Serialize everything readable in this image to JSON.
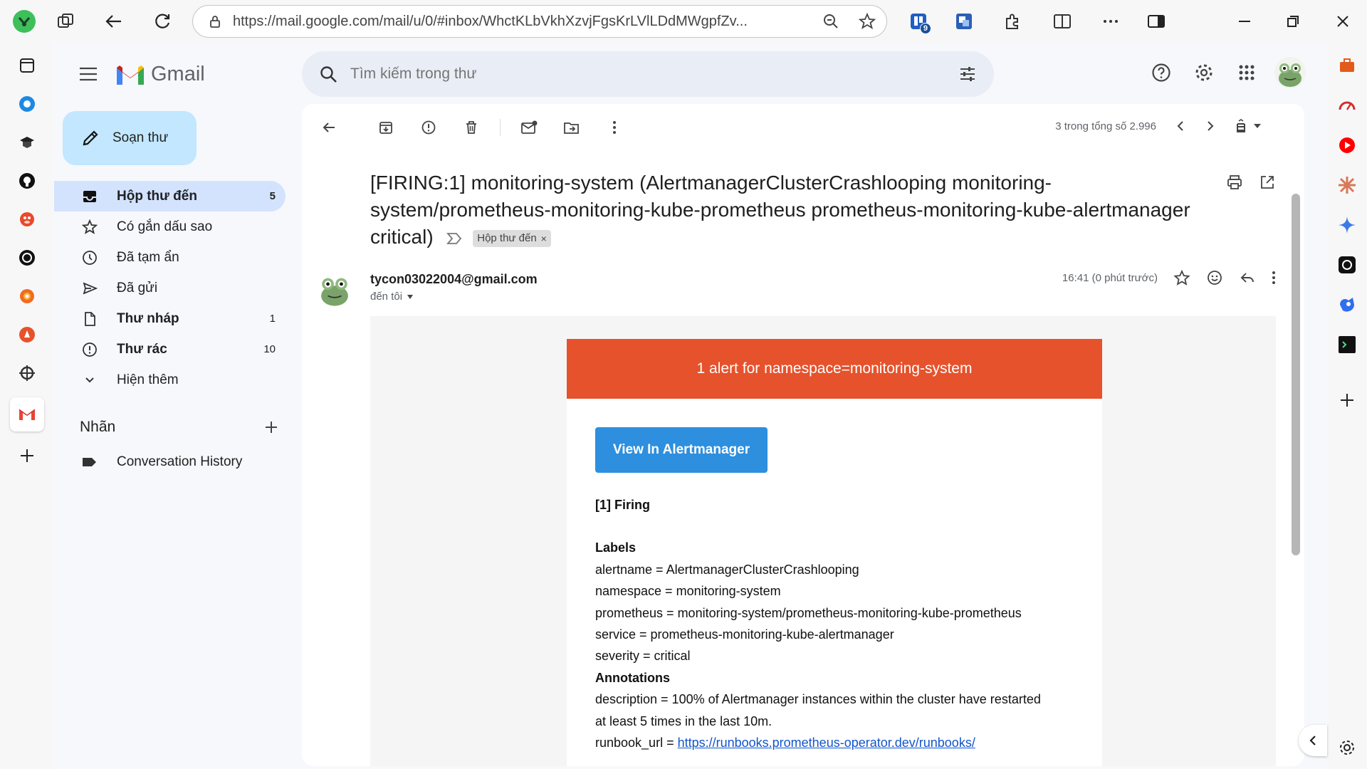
{
  "browser": {
    "url": "https://mail.google.com/mail/u/0/#inbox/WhctKLbVkhXzvjFgsKrLVlLDdMWgpfZv...",
    "extension_badge": "9"
  },
  "gmail": {
    "logo_text": "Gmail",
    "search_placeholder": "Tìm kiếm trong thư",
    "compose_label": "Soạn thư",
    "nav": [
      {
        "label": "Hộp thư đến",
        "count": "5"
      },
      {
        "label": "Có gắn dấu sao",
        "count": ""
      },
      {
        "label": "Đã tạm ẩn",
        "count": ""
      },
      {
        "label": "Đã gửi",
        "count": ""
      },
      {
        "label": "Thư nháp",
        "count": "1"
      },
      {
        "label": "Thư rác",
        "count": "10"
      },
      {
        "label": "Hiện thêm",
        "count": ""
      }
    ],
    "labels_header": "Nhãn",
    "labels": [
      {
        "label": "Conversation History"
      }
    ]
  },
  "toolbar": {
    "pager_text": "3 trong tổng số 2.996"
  },
  "message": {
    "subject": "[FIRING:1] monitoring-system (AlertmanagerClusterCrashlooping monitoring-system/prometheus-monitoring-kube-prometheus prometheus-monitoring-kube-alertmanager critical)",
    "tag": "Hộp thư đến",
    "sender": "tycon03022004@gmail.com",
    "to": "đến tôi",
    "time": "16:41 (0 phút trước)"
  },
  "email_body": {
    "header": "1 alert for namespace=monitoring-system",
    "button": "View In Alertmanager",
    "firing": "[1] Firing",
    "labels_title": "Labels",
    "labels": [
      "alertname = AlertmanagerClusterCrashlooping",
      "namespace = monitoring-system",
      "prometheus = monitoring-system/prometheus-monitoring-kube-prometheus",
      "service = prometheus-monitoring-kube-alertmanager",
      "severity = critical"
    ],
    "annotations_title": "Annotations",
    "description_1": "description = 100% of Alertmanager instances within the cluster have restarted",
    "description_2": "at least 5 times in the last 10m.",
    "runbook_prefix": "runbook_url = ",
    "runbook_link": "https://runbooks.prometheus-operator.dev/runbooks/"
  },
  "colors": {
    "alert_header": "#e6522c",
    "button": "#2d8fde",
    "compose_bg": "#c2e7ff",
    "nav_active": "#d3e3fd"
  }
}
